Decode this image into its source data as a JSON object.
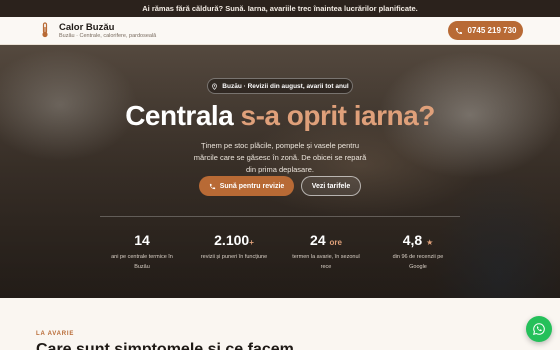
{
  "topbar": {
    "text": "Ai rămas fără căldură? Sună. Iarna, avariile trec înaintea lucrărilor planificate."
  },
  "header": {
    "brand": "Calor Buzău",
    "tagline": "Buzău · Centrale, calorifere, pardoseală",
    "logo_icon": "thermometer-icon",
    "phone_icon": "phone-icon",
    "phone": "0745 219 730"
  },
  "hero": {
    "pill": "Buzău · Revizii din august, avarii tot anul",
    "pill_icon": "location-pin-icon",
    "headline_main": "Centrala ",
    "headline_accent": "s-a oprit iarna?",
    "subtext": "Ținem pe stoc plăcile, pompele și vasele pentru mărcile care se găsesc în zonă. De obicei se repară din prima deplasare.",
    "primary_cta": "Sună pentru revizie",
    "primary_icon": "phone-icon",
    "secondary_cta": "Vezi tarifele",
    "colors": {
      "accent": "#b86a35",
      "accent_light": "#dfa07a",
      "dark": "#2b221c"
    }
  },
  "stats": [
    {
      "value": "14",
      "unit": "",
      "label": "ani pe centrale termice în Buzău"
    },
    {
      "value": "2.100",
      "unit": "+",
      "label": "revizii și puneri în funcțiune"
    },
    {
      "value": "24",
      "unit": "ore",
      "label": "termen la avarie, în sezonul rece"
    },
    {
      "value": "4,8",
      "unit": "★",
      "label": "din 96 de recenzii pe Google"
    }
  ],
  "section": {
    "eyebrow": "LA AVARIE",
    "title": "Care sunt simptomele și ce facem"
  },
  "whatsapp": {
    "icon": "whatsapp-icon"
  }
}
